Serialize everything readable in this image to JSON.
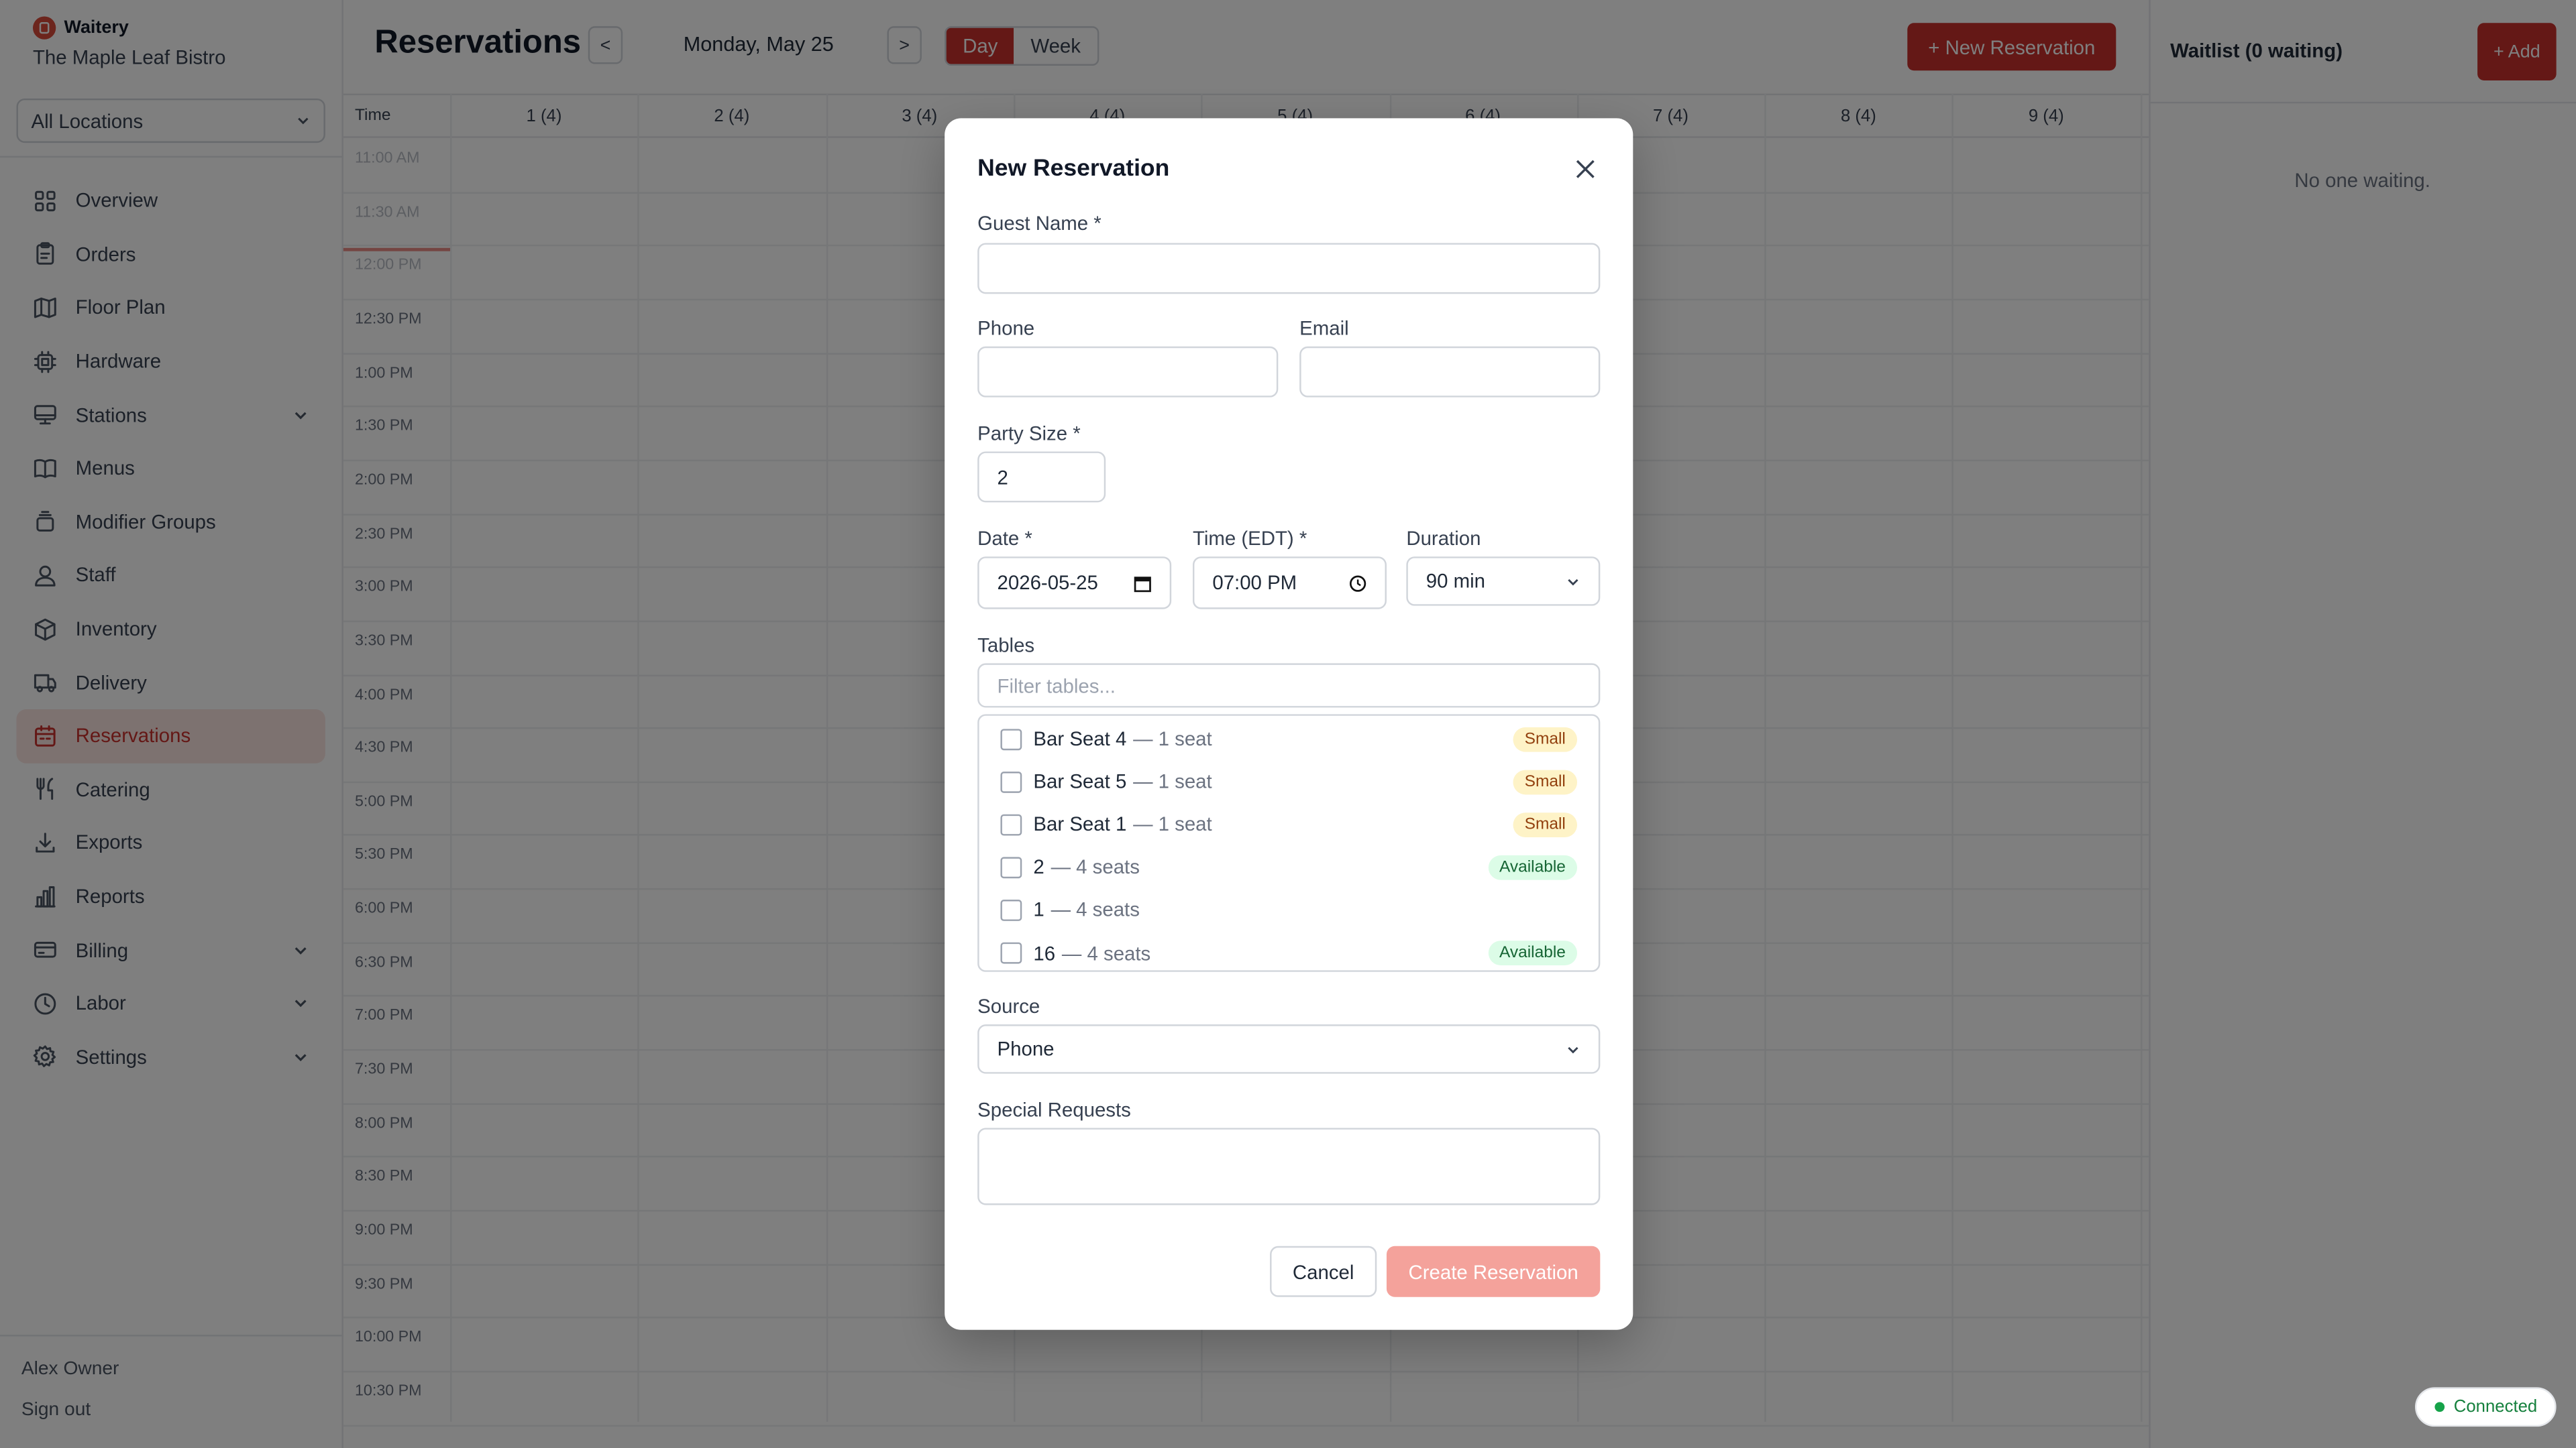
{
  "app": {
    "brand": "Waitery",
    "restaurant": "The Maple Leaf Bistro"
  },
  "sidebar": {
    "location_select": "All Locations",
    "items": [
      {
        "label": "Overview",
        "icon": "grid-icon",
        "active": false,
        "expandable": false
      },
      {
        "label": "Orders",
        "icon": "clipboard-icon",
        "active": false,
        "expandable": false
      },
      {
        "label": "Floor Plan",
        "icon": "map-icon",
        "active": false,
        "expandable": false
      },
      {
        "label": "Hardware",
        "icon": "cpu-icon",
        "active": false,
        "expandable": false
      },
      {
        "label": "Stations",
        "icon": "monitor-icon",
        "active": false,
        "expandable": true
      },
      {
        "label": "Menus",
        "icon": "book-icon",
        "active": false,
        "expandable": false
      },
      {
        "label": "Modifier Groups",
        "icon": "layers-icon",
        "active": false,
        "expandable": false
      },
      {
        "label": "Staff",
        "icon": "user-icon",
        "active": false,
        "expandable": false
      },
      {
        "label": "Inventory",
        "icon": "box-icon",
        "active": false,
        "expandable": false
      },
      {
        "label": "Delivery",
        "icon": "truck-icon",
        "active": false,
        "expandable": false
      },
      {
        "label": "Reservations",
        "icon": "calendar-icon",
        "active": true,
        "expandable": false
      },
      {
        "label": "Catering",
        "icon": "utensils-icon",
        "active": false,
        "expandable": false
      },
      {
        "label": "Exports",
        "icon": "download-icon",
        "active": false,
        "expandable": false
      },
      {
        "label": "Reports",
        "icon": "bar-chart-icon",
        "active": false,
        "expandable": false
      },
      {
        "label": "Billing",
        "icon": "credit-card-icon",
        "active": false,
        "expandable": true
      },
      {
        "label": "Labor",
        "icon": "clock-icon",
        "active": false,
        "expandable": true
      },
      {
        "label": "Settings",
        "icon": "gear-icon",
        "active": false,
        "expandable": true
      }
    ],
    "user_name": "Alex Owner",
    "sign_out": "Sign out"
  },
  "header": {
    "title": "Reservations",
    "prev_label": "<",
    "next_label": ">",
    "date": "Monday, May 25",
    "view_day": "Day",
    "view_week": "Week",
    "active_view": "Day",
    "new_button": "+ New Reservation"
  },
  "grid": {
    "time_header": "Time",
    "tables": [
      "1 (4)",
      "2 (4)",
      "3 (4)",
      "4 (4)",
      "5 (4)",
      "6 (4)",
      "7 (4)",
      "8 (4)",
      "9 (4)"
    ],
    "times": [
      "11:00 AM",
      "11:30 AM",
      "12:00 PM",
      "12:30 PM",
      "1:00 PM",
      "1:30 PM",
      "2:00 PM",
      "2:30 PM",
      "3:00 PM",
      "3:30 PM",
      "4:00 PM",
      "4:30 PM",
      "5:00 PM",
      "5:30 PM",
      "6:00 PM",
      "6:30 PM",
      "7:00 PM",
      "7:30 PM",
      "8:00 PM",
      "8:30 PM",
      "9:00 PM",
      "9:30 PM",
      "10:00 PM",
      "10:30 PM"
    ]
  },
  "waitlist": {
    "title": "Waitlist (0 waiting)",
    "add_button": "+ Add",
    "empty_text": "No one waiting."
  },
  "status": {
    "connection": "Connected"
  },
  "modal": {
    "title": "New Reservation",
    "guest_name_label": "Guest Name *",
    "guest_name_value": "",
    "phone_label": "Phone",
    "phone_value": "",
    "email_label": "Email",
    "email_value": "",
    "party_size_label": "Party Size *",
    "party_size_value": "2",
    "date_label": "Date *",
    "date_value": "2026-05-25",
    "time_label": "Time (EDT) *",
    "time_value": "07:00 PM",
    "duration_label": "Duration",
    "duration_value": "90 min",
    "tables_label": "Tables",
    "tables_filter_placeholder": "Filter tables...",
    "tables": [
      {
        "name": "Bar Seat 4",
        "seats": "— 1 seat",
        "badge": "Small",
        "badge_type": "small"
      },
      {
        "name": "Bar Seat 5",
        "seats": "— 1 seat",
        "badge": "Small",
        "badge_type": "small"
      },
      {
        "name": "Bar Seat 1",
        "seats": "— 1 seat",
        "badge": "Small",
        "badge_type": "small"
      },
      {
        "name": "2",
        "seats": "— 4 seats",
        "badge": "Available",
        "badge_type": "avail"
      },
      {
        "name": "1",
        "seats": "— 4 seats",
        "badge": "",
        "badge_type": ""
      },
      {
        "name": "16",
        "seats": "— 4 seats",
        "badge": "Available",
        "badge_type": "avail"
      }
    ],
    "source_label": "Source",
    "source_value": "Phone",
    "special_requests_label": "Special Requests",
    "special_requests_value": "",
    "cancel_button": "Cancel",
    "create_button": "Create Reservation"
  },
  "colors": {
    "accent": "#c9302c",
    "accent_light": "#fbe4e1",
    "create_disabled": "#f4a29b",
    "connected": "#16a34a"
  }
}
